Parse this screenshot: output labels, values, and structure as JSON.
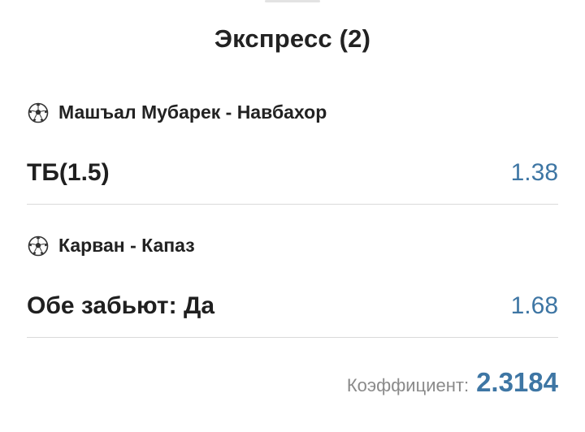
{
  "title": "Экспресс (2)",
  "events": [
    {
      "icon": "soccer-ball-icon",
      "match": "Машъал Мубарек - Навбахор",
      "bet": "ТБ(1.5)",
      "odds": "1.38"
    },
    {
      "icon": "soccer-ball-icon",
      "match": "Карван - Капаз",
      "bet": "Обе забьют: Да",
      "odds": "1.68"
    }
  ],
  "total": {
    "label": "Коэффициент:",
    "value": "2.3184"
  },
  "colors": {
    "accent": "#3e76a4",
    "muted": "#8a8a8a",
    "divider": "#dadada"
  }
}
